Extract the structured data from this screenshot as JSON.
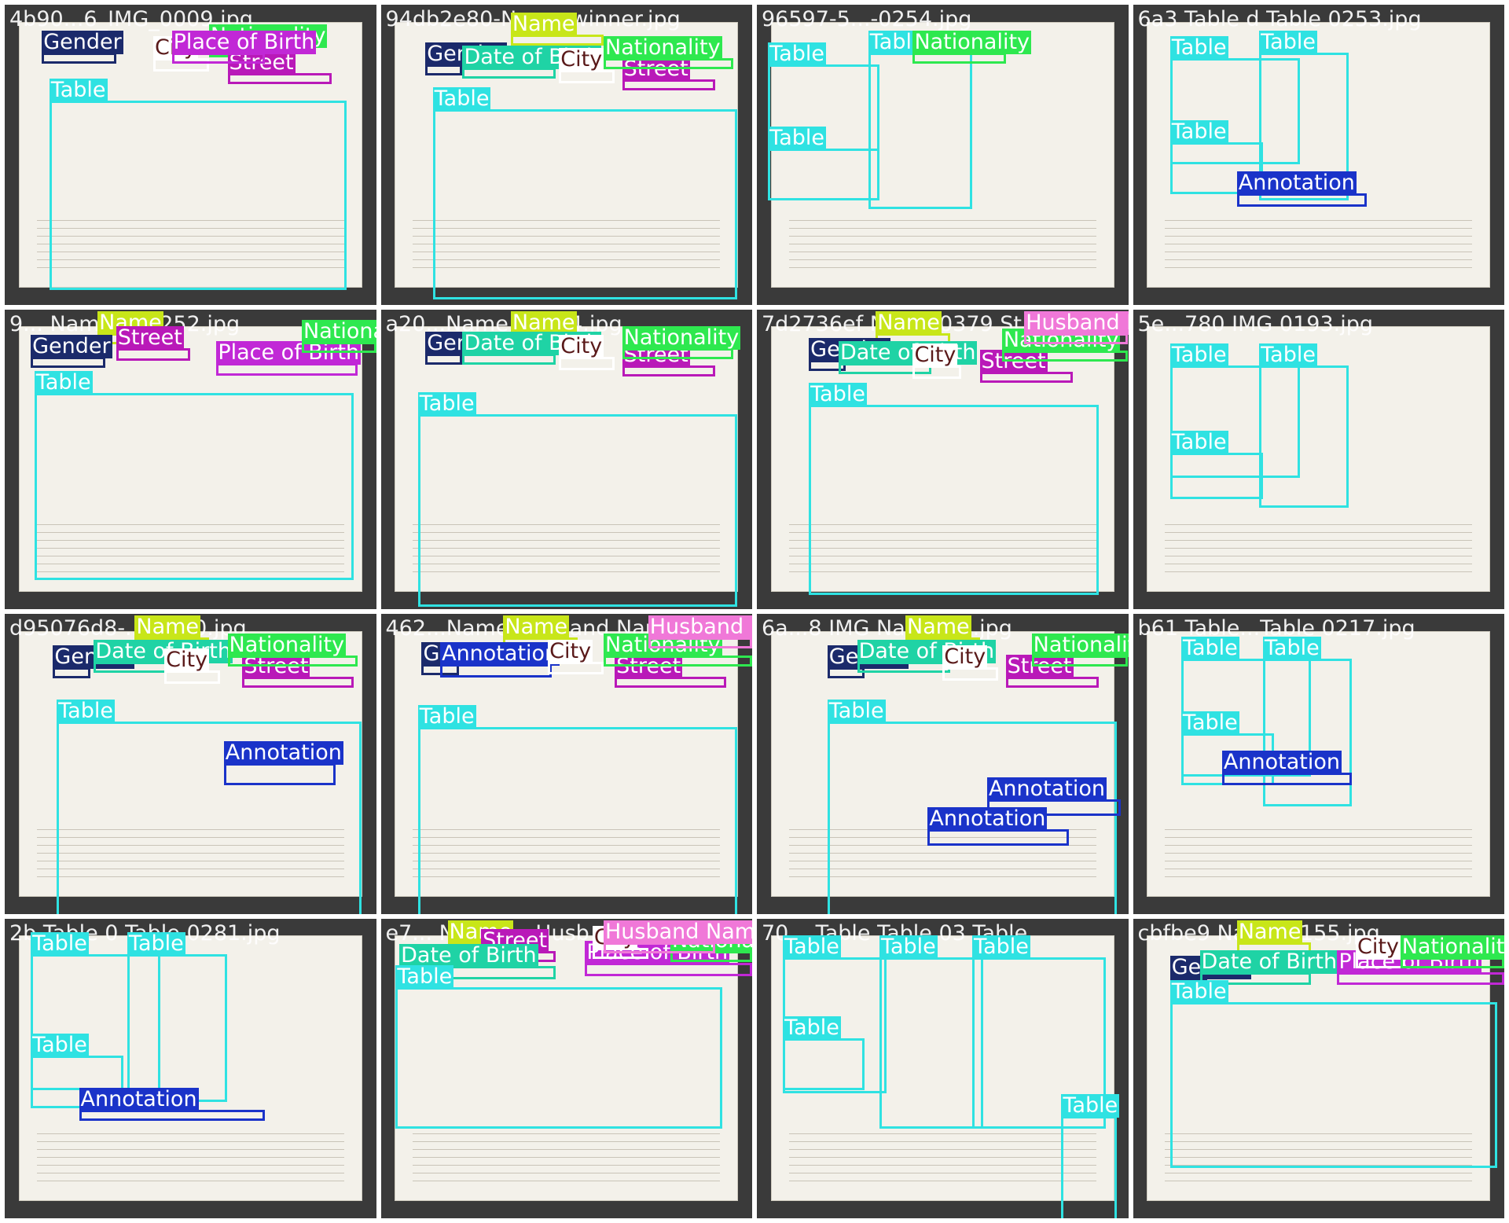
{
  "image": {
    "description_free": true
  },
  "colors": {
    "Table": "#2fe2e2",
    "Name": "#c8e619",
    "Gender": "#1b2a6b",
    "Date of Birth": "#1fd3a5",
    "Place of Birth": "#c128d6",
    "City": "#ffffff",
    "Street": "#b919b8",
    "Nationality": "#2ee84f",
    "Annotation": "#1a33c9",
    "Husband Name": "#f078d8"
  },
  "label_text_colors": {
    "Table": "#ffffff",
    "Name": "#ffffff",
    "Gender": "#ffffff",
    "Date of Birth": "#ffffff",
    "Place of Birth": "#ffffff",
    "City": "#5a1a1a",
    "Street": "#ffffff",
    "Nationality": "#ffffff",
    "Annotation": "#ffffff",
    "Husband Name": "#ffffff"
  },
  "tiles": [
    {
      "title": "4b90...6_IMG_0009.jpg",
      "boxes": [
        [
          "Gender",
          0.1,
          0.08,
          0.2,
          0.06
        ],
        [
          "Nationality",
          0.55,
          0.06,
          0.2,
          0.06
        ],
        [
          "City",
          0.4,
          0.1,
          0.15,
          0.07
        ],
        [
          "Street",
          0.6,
          0.15,
          0.28,
          0.06
        ],
        [
          "Table",
          0.12,
          0.24,
          0.8,
          0.66
        ],
        [
          "Place of Birth",
          0.45,
          0.08,
          0.25,
          0.05
        ]
      ]
    },
    {
      "title": "94db2e80-Name-winner.jpg",
      "boxes": [
        [
          "Name",
          0.35,
          0.02,
          0.25,
          0.06
        ],
        [
          "Gender",
          0.12,
          0.12,
          0.1,
          0.06
        ],
        [
          "Date of Birth",
          0.22,
          0.13,
          0.25,
          0.06
        ],
        [
          "City",
          0.48,
          0.14,
          0.15,
          0.07
        ],
        [
          "Street",
          0.65,
          0.17,
          0.25,
          0.06
        ],
        [
          "Nationality",
          0.6,
          0.1,
          0.35,
          0.05
        ],
        [
          "Table",
          0.14,
          0.27,
          0.82,
          0.66
        ]
      ]
    },
    {
      "title": "96597-5...-0254.jpg",
      "boxes": [
        [
          "Table",
          0.03,
          0.12,
          0.3,
          0.48
        ],
        [
          "Table",
          0.3,
          0.08,
          0.28,
          0.55
        ],
        [
          "Table",
          0.03,
          0.4,
          0.3,
          0.2
        ],
        [
          "Nationality",
          0.42,
          0.08,
          0.25,
          0.05
        ]
      ]
    },
    {
      "title": "6a3 Table d Table 0253.jpg",
      "boxes": [
        [
          "Table",
          0.1,
          0.1,
          0.35,
          0.38
        ],
        [
          "Table",
          0.34,
          0.08,
          0.24,
          0.52
        ],
        [
          "Table",
          0.1,
          0.38,
          0.25,
          0.2
        ],
        [
          "Annotation",
          0.28,
          0.55,
          0.35,
          0.07
        ]
      ]
    },
    {
      "title": "9... Name ... 0252.jpg",
      "boxes": [
        [
          "Name",
          0.25,
          0.0,
          0.18,
          0.05
        ],
        [
          "Gender",
          0.07,
          0.08,
          0.2,
          0.06
        ],
        [
          "Street",
          0.3,
          0.05,
          0.2,
          0.07
        ],
        [
          "Place of Birth",
          0.57,
          0.1,
          0.38,
          0.07
        ],
        [
          "Nationality",
          0.8,
          0.03,
          0.2,
          0.06
        ],
        [
          "Table",
          0.08,
          0.2,
          0.86,
          0.65
        ]
      ]
    },
    {
      "title": "a20...Name...0724.jpg",
      "boxes": [
        [
          "Name",
          0.35,
          0.0,
          0.2,
          0.06
        ],
        [
          "Gender",
          0.12,
          0.07,
          0.1,
          0.06
        ],
        [
          "Date of Birth",
          0.22,
          0.07,
          0.25,
          0.06
        ],
        [
          "City",
          0.48,
          0.08,
          0.15,
          0.07
        ],
        [
          "Street",
          0.65,
          0.11,
          0.25,
          0.06
        ],
        [
          "Nationality",
          0.65,
          0.05,
          0.3,
          0.05
        ],
        [
          "Table",
          0.1,
          0.27,
          0.86,
          0.67
        ]
      ]
    },
    {
      "title": "7d2736ef Name 0379 St Husband Na",
      "boxes": [
        [
          "Name",
          0.32,
          0.0,
          0.2,
          0.06
        ],
        [
          "Gender",
          0.14,
          0.09,
          0.1,
          0.06
        ],
        [
          "Date of Birth",
          0.22,
          0.1,
          0.25,
          0.06
        ],
        [
          "City",
          0.42,
          0.11,
          0.13,
          0.07
        ],
        [
          "Street",
          0.6,
          0.13,
          0.25,
          0.06
        ],
        [
          "Nationality",
          0.66,
          0.06,
          0.34,
          0.05
        ],
        [
          "Husband Name",
          0.72,
          0.0,
          0.28,
          0.05
        ],
        [
          "Table",
          0.14,
          0.24,
          0.78,
          0.66
        ]
      ]
    },
    {
      "title": "5e...780 IMG 0193.jpg",
      "boxes": [
        [
          "Table",
          0.1,
          0.11,
          0.35,
          0.4
        ],
        [
          "Table",
          0.34,
          0.11,
          0.24,
          0.5
        ],
        [
          "Table",
          0.1,
          0.4,
          0.25,
          0.18
        ]
      ]
    },
    {
      "title": "d95076d8-...-0270.jpg",
      "boxes": [
        [
          "Name",
          0.35,
          0.0,
          0.2,
          0.06
        ],
        [
          "Gender",
          0.13,
          0.1,
          0.1,
          0.06
        ],
        [
          "Date of Birth",
          0.24,
          0.08,
          0.25,
          0.06
        ],
        [
          "City",
          0.43,
          0.11,
          0.15,
          0.07
        ],
        [
          "Street",
          0.64,
          0.13,
          0.3,
          0.06
        ],
        [
          "Nationality",
          0.6,
          0.06,
          0.35,
          0.05
        ],
        [
          "Table",
          0.14,
          0.28,
          0.82,
          0.68
        ],
        [
          "Annotation",
          0.59,
          0.42,
          0.3,
          0.1
        ]
      ]
    },
    {
      "title": "462...Name Husband Name...",
      "boxes": [
        [
          "Name",
          0.33,
          0.0,
          0.2,
          0.06
        ],
        [
          "Gender",
          0.11,
          0.09,
          0.1,
          0.06
        ],
        [
          "Annotation",
          0.16,
          0.09,
          0.3,
          0.07
        ],
        [
          "City",
          0.45,
          0.08,
          0.15,
          0.07
        ],
        [
          "Street",
          0.63,
          0.13,
          0.3,
          0.06
        ],
        [
          "Nationality",
          0.6,
          0.06,
          0.4,
          0.05
        ],
        [
          "Husband Name",
          0.72,
          0.0,
          0.28,
          0.05
        ],
        [
          "Table",
          0.1,
          0.3,
          0.86,
          0.66
        ]
      ]
    },
    {
      "title": "6a...8 IMG Name 67.jpg",
      "boxes": [
        [
          "Name",
          0.4,
          0.0,
          0.2,
          0.06
        ],
        [
          "Gender",
          0.19,
          0.1,
          0.1,
          0.06
        ],
        [
          "Date of Birth",
          0.27,
          0.08,
          0.25,
          0.06
        ],
        [
          "City",
          0.5,
          0.1,
          0.15,
          0.07
        ],
        [
          "Street",
          0.67,
          0.13,
          0.25,
          0.06
        ],
        [
          "Nationality",
          0.74,
          0.06,
          0.26,
          0.05
        ],
        [
          "Table",
          0.19,
          0.28,
          0.78,
          0.68
        ],
        [
          "Annotation",
          0.62,
          0.54,
          0.36,
          0.08
        ],
        [
          "Annotation",
          0.46,
          0.64,
          0.38,
          0.08
        ]
      ]
    },
    {
      "title": "b61 Table...Table 0217.jpg",
      "boxes": [
        [
          "Table",
          0.13,
          0.07,
          0.35,
          0.42
        ],
        [
          "Table",
          0.35,
          0.07,
          0.24,
          0.52
        ],
        [
          "Table",
          0.13,
          0.32,
          0.25,
          0.2
        ],
        [
          "Annotation",
          0.24,
          0.45,
          0.35,
          0.07
        ]
      ]
    },
    {
      "title": "2b Table 0 Table 0281.jpg",
      "boxes": [
        [
          "Table",
          0.07,
          0.04,
          0.35,
          0.48
        ],
        [
          "Table",
          0.33,
          0.04,
          0.27,
          0.52
        ],
        [
          "Table",
          0.07,
          0.38,
          0.25,
          0.2
        ],
        [
          "Annotation",
          0.2,
          0.56,
          0.5,
          0.06
        ]
      ]
    },
    {
      "title": "e7... Name ... Husb",
      "boxes": [
        [
          "Name",
          0.18,
          0.0,
          0.2,
          0.06
        ],
        [
          "Street",
          0.27,
          0.03,
          0.2,
          0.06
        ],
        [
          "Date of Birth",
          0.05,
          0.08,
          0.42,
          0.07
        ],
        [
          "Place of Birth",
          0.55,
          0.07,
          0.45,
          0.07
        ],
        [
          "Nationality",
          0.78,
          0.03,
          0.22,
          0.06
        ],
        [
          "City",
          0.57,
          0.02,
          0.15,
          0.06
        ],
        [
          "Table",
          0.04,
          0.15,
          0.88,
          0.5
        ],
        [
          "Husband Name",
          0.6,
          0.0,
          0.3,
          0.05
        ]
      ]
    },
    {
      "title": "70... Table Table 03 Table",
      "boxes": [
        [
          "Table",
          0.07,
          0.05,
          0.28,
          0.48
        ],
        [
          "Table",
          0.33,
          0.05,
          0.28,
          0.6
        ],
        [
          "Table",
          0.58,
          0.05,
          0.36,
          0.6
        ],
        [
          "Table",
          0.07,
          0.32,
          0.22,
          0.2
        ],
        [
          "Table",
          0.82,
          0.58,
          0.15,
          0.4
        ]
      ]
    },
    {
      "title": "cbfbe9 Name 0155.jpg",
      "boxes": [
        [
          "Name",
          0.28,
          0.0,
          0.2,
          0.06
        ],
        [
          "Gender",
          0.1,
          0.12,
          0.1,
          0.06
        ],
        [
          "Date of Birth",
          0.18,
          0.1,
          0.3,
          0.07
        ],
        [
          "Place of Birth",
          0.55,
          0.1,
          0.45,
          0.07
        ],
        [
          "City",
          0.6,
          0.05,
          0.13,
          0.06
        ],
        [
          "Nationality",
          0.72,
          0.05,
          0.28,
          0.05
        ],
        [
          "Table",
          0.1,
          0.2,
          0.88,
          0.58
        ]
      ]
    }
  ]
}
